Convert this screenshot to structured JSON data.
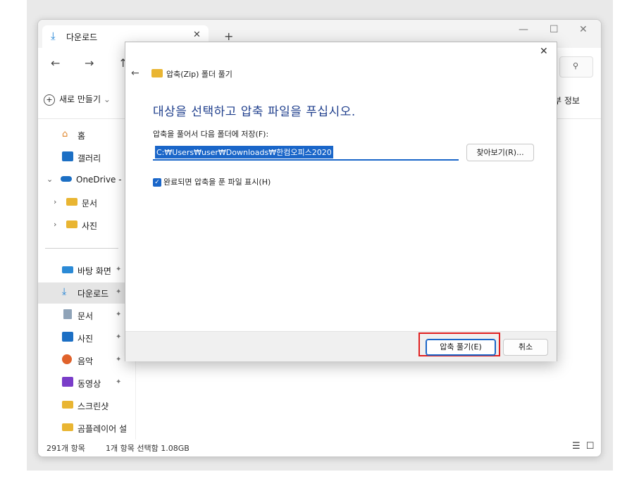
{
  "explorer": {
    "tab_label": "다운로드",
    "new_tab": "+",
    "toolbar": {
      "new_label": "새로 만들기",
      "details_label": "부 정보"
    },
    "sidebar": {
      "home": "홈",
      "gallery": "갤러리",
      "onedrive": "OneDrive - P",
      "od_docs": "문서",
      "od_photos": "사진",
      "desktop": "바탕 화면",
      "downloads": "다운로드",
      "documents": "문서",
      "pictures": "사진",
      "music": "음악",
      "videos": "동영상",
      "screenshots": "스크린샷",
      "gomplayer": "곰플레이어 설"
    },
    "status": {
      "count": "291개 항목",
      "selection": "1개 항목 선택함 1.08GB"
    }
  },
  "dialog": {
    "title": "압축(Zip) 폴더 풀기",
    "heading": "대상을 선택하고 압축 파일을 푸십시오.",
    "dest_label": "압축을 풀어서 다음 폴더에 저장(F):",
    "path_value": "C:₩Users₩user₩Downloads₩한컴오피스2020",
    "browse_label": "찾아보기(R)...",
    "checkbox_label": "완료되면 압축을 푼 파일 표시(H)",
    "checkbox_checked": true,
    "extract_label": "압축 풀기(E)",
    "cancel_label": "취소"
  },
  "colors": {
    "accent": "#1a66c9",
    "heading": "#1e3e8c",
    "highlight": "#e02020",
    "folder": "#e9b532"
  }
}
